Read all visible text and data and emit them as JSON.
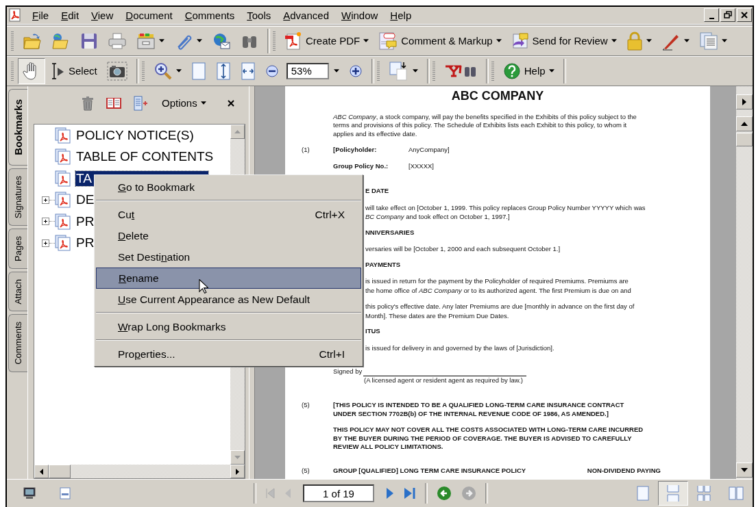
{
  "menu_bar": [
    {
      "key": "F",
      "post": "ile"
    },
    {
      "key": "E",
      "post": "dit"
    },
    {
      "key": "V",
      "post": "iew"
    },
    {
      "key": "D",
      "post": "ocument"
    },
    {
      "key": "C",
      "post": "omments"
    },
    {
      "key": "T",
      "post": "ools"
    },
    {
      "key": "A",
      "post": "dvanced"
    },
    {
      "key": "W",
      "post": "indow"
    },
    {
      "key": "H",
      "post": "elp"
    }
  ],
  "task_buttons": [
    {
      "kind": "create_pdf",
      "label": "Create PDF"
    },
    {
      "kind": "comment",
      "label": "Comment & Markup"
    },
    {
      "kind": "review",
      "label": "Send for Review"
    },
    {
      "kind": "secure"
    },
    {
      "kind": "sign"
    },
    {
      "kind": "forms"
    }
  ],
  "tools": [
    {
      "kind": "hand",
      "selected": true
    },
    {
      "kind": "select",
      "label": "Select",
      "selected": false
    },
    {
      "kind": "snapshot",
      "selected": false
    }
  ],
  "zoom_value": "53%",
  "help_label": "Help",
  "side_tabs": [
    {
      "label": "Bookmarks",
      "selected": true
    },
    {
      "label": "Signatures",
      "selected": false
    },
    {
      "label": "Pages",
      "selected": false
    },
    {
      "label": "Attach",
      "selected": false
    },
    {
      "label": "Comments",
      "selected": false
    }
  ],
  "bookmarks_panel": {
    "options_label": "Options",
    "items": [
      {
        "kind": "leaf",
        "label": "POLICY NOTICE(S)",
        "selected": false
      },
      {
        "kind": "leaf",
        "label": "TABLE OF CONTENTS",
        "selected": false
      },
      {
        "kind": "leaf",
        "label": "TA",
        "selected": true
      },
      {
        "kind": "folder",
        "label": "DE",
        "selected": false,
        "expanded": false
      },
      {
        "kind": "folder",
        "label": "PR",
        "selected": false,
        "expanded": false
      },
      {
        "kind": "folder",
        "label": "PR",
        "selected": false,
        "expanded": false
      }
    ]
  },
  "document": {
    "heading": "ABC COMPANY",
    "blocks": [
      {
        "kind": "para",
        "text": "*ABC Company*, a stock company, will pay the benefits specified in the Exhibits of this policy subject to the terms and provisions of this policy. The Schedule of Exhibits lists each Exhibit to this policy, to whom it applies and its effective date."
      },
      {
        "kind": "field",
        "number": "(1)",
        "label": "[Policyholder:",
        "value": "AnyCompany]"
      },
      {
        "kind": "field",
        "label": "Group Policy No.:",
        "value": "[XXXXX]"
      },
      {
        "kind": "cut_heading",
        "text": "E DATE"
      },
      {
        "kind": "cut_lines",
        "lines": [
          "will take effect on [October 1, 1999. This policy replaces Group Policy Number YYYYY which was",
          "*BC Company* and took effect on October 1, 1997.]"
        ]
      },
      {
        "kind": "cut_heading",
        "text": "NNIVERSARIES"
      },
      {
        "kind": "cut_lines",
        "lines": [
          "versaries will be [October 1, 2000 and each subsequent October 1.]"
        ]
      },
      {
        "kind": "cut_heading",
        "text": "PAYMENTS"
      },
      {
        "kind": "cut_lines",
        "lines": [
          "is issued in return for the payment by the Policyholder of required Premiums. Premiums are",
          "the home office of *ABC Company* or to its authorized agent. The first Premium is due on and"
        ]
      },
      {
        "kind": "cut_lines",
        "lines": [
          "this policy's effective date. Any later Premiums are due [monthly in advance on the first day of",
          "Month]. These dates are the Premium Due Dates."
        ]
      },
      {
        "kind": "cut_heading",
        "text": "ITUS"
      },
      {
        "kind": "cut_lines",
        "lines": [
          "is issued for delivery in and governed by the laws of [Jurisdiction]."
        ]
      },
      {
        "kind": "signature",
        "label": "Signed by",
        "note": "(A licensed agent or resident agent as required by law.)"
      },
      {
        "kind": "caps_para",
        "number": "(5)",
        "text": "[THIS POLICY IS INTENDED TO BE A QUALIFIED LONG-TERM CARE INSURANCE CONTRACT UNDER SECTION 7702B(b) OF THE INTERNAL REVENUE CODE OF 1986, AS AMENDED.]"
      },
      {
        "kind": "caps_para",
        "text": "THIS POLICY MAY NOT COVER ALL THE COSTS ASSOCIATED WITH LONG-TERM CARE INCURRED BY THE BUYER DURING THE PERIOD OF COVERAGE. THE BUYER IS ADVISED TO CAREFULLY REVIEW ALL POLICY LIMITATIONS."
      },
      {
        "kind": "footer_row",
        "number": "(5)",
        "left": "GROUP [QUALIFIED] LONG TERM CARE INSURANCE POLICY",
        "right": "NON-DIVIDEND PAYING"
      }
    ]
  },
  "context_menu": {
    "groups": [
      [
        {
          "key": "G",
          "post": "o to Bookmark",
          "selected": false
        }
      ],
      [
        {
          "pre": "Cu",
          "key": "t",
          "shortcut": "Ctrl+X",
          "selected": false
        },
        {
          "key": "D",
          "post": "elete",
          "selected": false
        },
        {
          "pre": "Set Desti",
          "key": "n",
          "post": "ation",
          "selected": false
        },
        {
          "key": "R",
          "post": "ename",
          "selected": true
        },
        {
          "key": "U",
          "post": "se Current Appearance as New Default",
          "selected": false
        }
      ],
      [
        {
          "key": "W",
          "post": "rap Long Bookmarks",
          "selected": false
        }
      ],
      [
        {
          "pre": "Pro",
          "key": "p",
          "post": "erties...",
          "shortcut": "Ctrl+I",
          "selected": false
        }
      ]
    ]
  },
  "status_bar": {
    "page_field": "1 of 19"
  }
}
